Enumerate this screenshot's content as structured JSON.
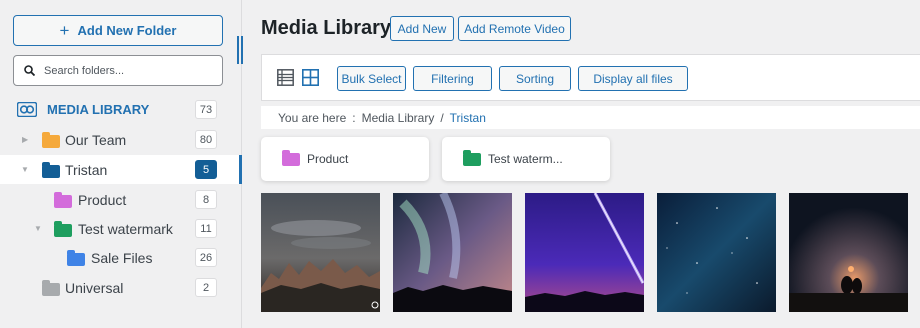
{
  "sidebar": {
    "add_folder_label": "Add New Folder",
    "search_placeholder": "Search folders...",
    "root": {
      "label": "MEDIA LIBRARY",
      "count": "73"
    },
    "folders": [
      {
        "label": "Our Team",
        "count": "80",
        "color": "#f5a93b"
      },
      {
        "label": "Tristan",
        "count": "5",
        "color": "#135e96",
        "selected": true
      },
      {
        "label": "Product",
        "count": "8",
        "color": "#d36cdb"
      },
      {
        "label": "Test watermark",
        "count": "11",
        "color": "#1e9e5f"
      },
      {
        "label": "Sale Files",
        "count": "26",
        "color": "#3f83e6"
      },
      {
        "label": "Universal",
        "count": "2",
        "color": "#a7aaad"
      }
    ]
  },
  "header": {
    "title": "Media Library",
    "add_new_label": "Add New",
    "add_remote_label": "Add Remote Video"
  },
  "toolbar": {
    "bulk_select_label": "Bulk Select",
    "filtering_label": "Filtering",
    "sorting_label": "Sorting",
    "display_all_label": "Display all files"
  },
  "breadcrumb": {
    "prefix": "You are here",
    "separator": ":",
    "root": "Media Library",
    "slash": "/",
    "current": "Tristan"
  },
  "subfolders": [
    {
      "label": "Product",
      "color": "#d36cdb"
    },
    {
      "label": "Test waterm...",
      "color": "#1e9e5f"
    }
  ],
  "colors": {
    "accent": "#2271b1",
    "selected": "#135e96"
  }
}
